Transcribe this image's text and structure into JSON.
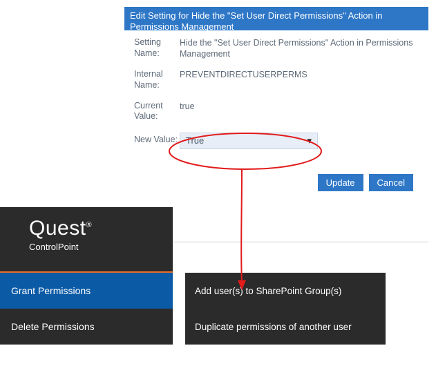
{
  "dialog": {
    "title": "Edit Setting for Hide the \"Set User Direct Permissions\" Action in Permissions Management",
    "setting_name_label": "Setting Name:",
    "setting_name_value": "Hide the \"Set User Direct Permissions\" Action in Permissions Management",
    "internal_name_label": "Internal Name:",
    "internal_name_value": "PREVENTDIRECTUSERPERMS",
    "current_value_label": "Current Value:",
    "current_value_value": "true",
    "new_value_label": "New Value:",
    "new_value_option": "True",
    "update_label": "Update",
    "cancel_label": "Cancel"
  },
  "brand": {
    "name": "Quest",
    "registered": "®",
    "product": "ControlPoint"
  },
  "left_menu": {
    "grant": "Grant Permissions",
    "delete": "Delete Permissions"
  },
  "right_menu": {
    "add_users": "Add user(s) to SharePoint Group(s)",
    "duplicate": "Duplicate permissions of another user"
  },
  "annotation": {
    "ellipse_color": "#e21b1b",
    "arrow_color": "#e21b1b"
  }
}
